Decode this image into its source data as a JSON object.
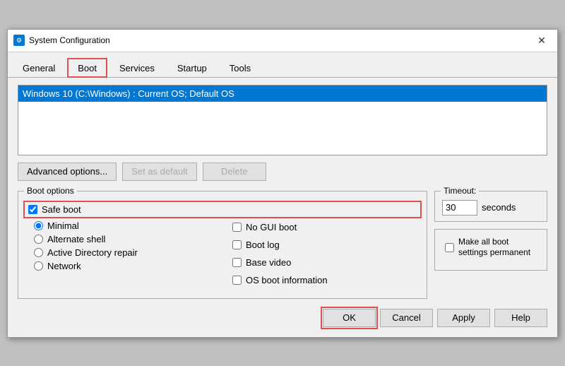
{
  "window": {
    "title": "System Configuration",
    "icon": "⚙"
  },
  "tabs": [
    {
      "label": "General",
      "active": false
    },
    {
      "label": "Boot",
      "active": true
    },
    {
      "label": "Services",
      "active": false
    },
    {
      "label": "Startup",
      "active": false
    },
    {
      "label": "Tools",
      "active": false
    }
  ],
  "boot_list": {
    "items": [
      {
        "text": "Windows 10 (C:\\Windows) : Current OS; Default OS",
        "selected": true
      }
    ]
  },
  "action_buttons": {
    "advanced": "Advanced options...",
    "set_default": "Set as default",
    "delete": "Delete"
  },
  "boot_options": {
    "group_title": "Boot options",
    "safe_boot": {
      "label": "Safe boot",
      "checked": true
    },
    "radios": [
      {
        "label": "Minimal",
        "checked": true
      },
      {
        "label": "Alternate shell",
        "checked": false
      },
      {
        "label": "Active Directory repair",
        "checked": false
      },
      {
        "label": "Network",
        "checked": false
      }
    ],
    "checkboxes": [
      {
        "label": "No GUI boot",
        "checked": false
      },
      {
        "label": "Boot log",
        "checked": false
      },
      {
        "label": "Base video",
        "checked": false
      },
      {
        "label": "OS boot information",
        "checked": false
      }
    ]
  },
  "timeout": {
    "label": "Timeout:",
    "value": "30",
    "unit": "seconds"
  },
  "permanent": {
    "label": "Make all boot settings permanent",
    "checked": false
  },
  "bottom_buttons": {
    "ok": "OK",
    "cancel": "Cancel",
    "apply": "Apply",
    "help": "Help"
  }
}
